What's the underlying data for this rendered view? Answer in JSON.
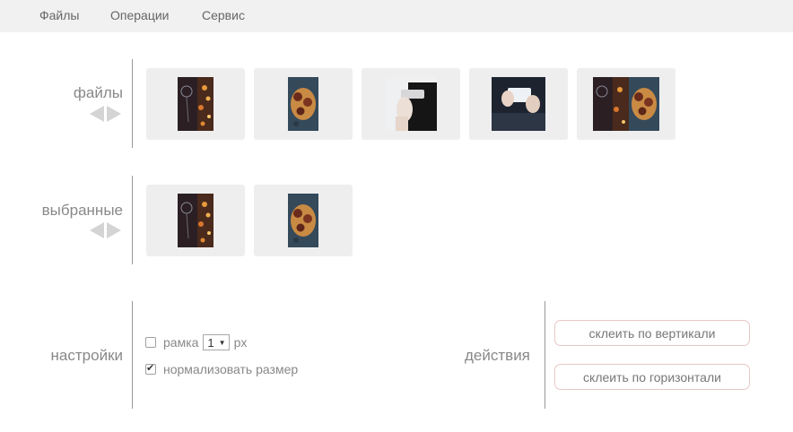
{
  "menu": {
    "items": [
      "Файлы",
      "Операции",
      "Сервис"
    ]
  },
  "files": {
    "label": "файлы"
  },
  "selected": {
    "label": "выбранные"
  },
  "settings": {
    "label": "настройки",
    "frame_label": "рамка",
    "frame_value": "1",
    "frame_unit": "px",
    "frame_checked": false,
    "normalize_label": "нормализовать размер",
    "normalize_checked": true
  },
  "actions": {
    "label": "действия",
    "vertical_label": "склеить по вертикали",
    "horizontal_label": "склеить по горизонтали"
  },
  "colors": {
    "menubar_bg": "#f1f1f1",
    "thumb_bg": "#eeeeee",
    "button_border": "#e8c8c4"
  }
}
